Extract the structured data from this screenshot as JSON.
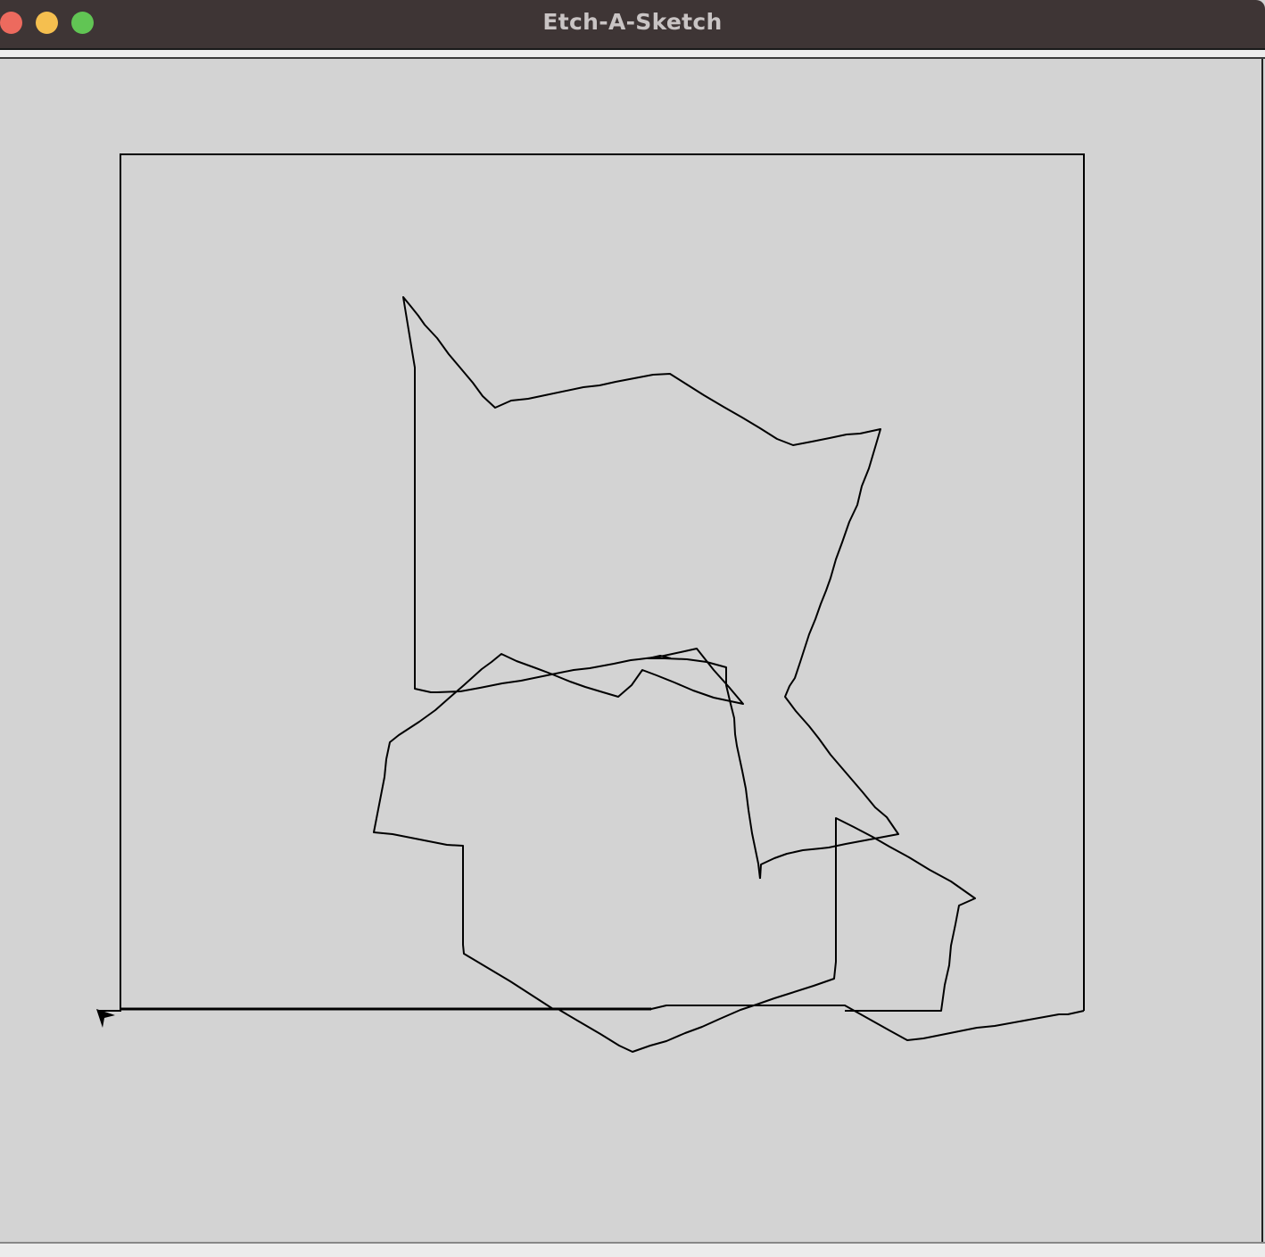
{
  "window": {
    "title": "Etch-A-Sketch",
    "controls": {
      "close_color": "#ed6a5e",
      "minimize_color": "#f5bf4f",
      "maximize_color": "#61c554"
    }
  },
  "canvas": {
    "background": "#d3d3d3",
    "line_color": "#000000",
    "cursor_icon": "turtle-arrow-icon"
  }
}
